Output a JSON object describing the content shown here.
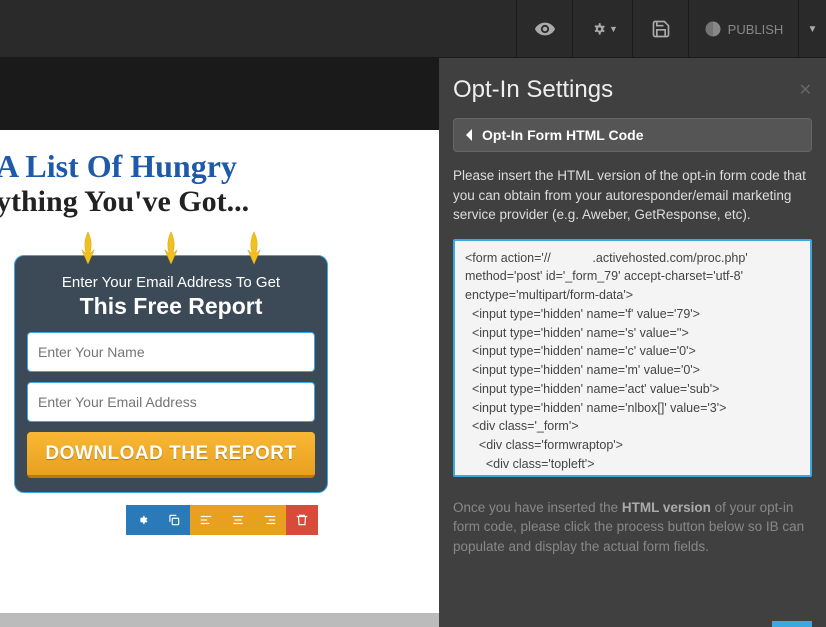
{
  "topbar": {
    "publish_label": "PUBLISH"
  },
  "headline": {
    "line1": "A List Of Hungry",
    "line2": "ything You've Got..."
  },
  "form": {
    "subheading": "Enter Your Email Address To Get",
    "heading": "This Free Report",
    "name_placeholder": "Enter Your Name",
    "email_placeholder": "Enter Your Email Address",
    "button_label": "DOWNLOAD THE REPORT"
  },
  "panel": {
    "title": "Opt-In Settings",
    "back_label": "Opt-In Form HTML Code",
    "instructions": "Please insert the HTML version of the opt-in form code that you can obtain from your autoresponder/email marketing service provider (e.g. Aweber, GetResponse, etc).",
    "code": "<form action='//            .activehosted.com/proc.php' method='post' id='_form_79' accept-charset='utf-8' enctype='multipart/form-data'>\n  <input type='hidden' name='f' value='79'>\n  <input type='hidden' name='s' value=''>\n  <input type='hidden' name='c' value='0'>\n  <input type='hidden' name='m' value='0'>\n  <input type='hidden' name='act' value='sub'>\n  <input type='hidden' name='nlbox[]' value='3'>\n  <div class='_form'>\n    <div class='formwraptop'>\n      <div class='topleft'>\n      </div>\n      <div class='topbg'>",
    "post_instructions_1": "Once you have inserted the ",
    "post_instructions_bold": "HTML version",
    "post_instructions_2": " of your opt-in form code, please click the process button below so IB can populate and display the actual form fields."
  }
}
